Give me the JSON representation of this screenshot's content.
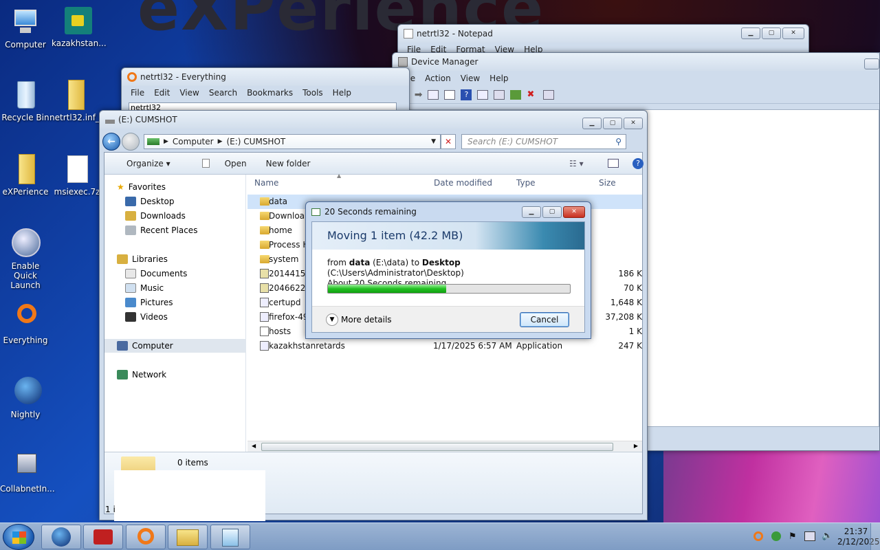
{
  "wallpaper_text": "eXPerience",
  "desktop_icons": [
    {
      "label": "Computer",
      "icon": "computer-icon"
    },
    {
      "label": "kazakhstan...",
      "icon": "app-icon"
    },
    {
      "label": "Recycle Bin",
      "icon": "recycle-bin-icon"
    },
    {
      "label": "netrtl32.inf_...",
      "icon": "folder-icon"
    },
    {
      "label": "eXPerience",
      "icon": "folder-icon"
    },
    {
      "label": "msiexec.7z",
      "icon": "file-icon"
    },
    {
      "label": "Enable Quick Launch",
      "icon": "quick-launch-icon"
    },
    {
      "label": "Everything",
      "icon": "everything-icon"
    },
    {
      "label": "Nightly",
      "icon": "nightly-icon"
    },
    {
      "label": "CollabnetIn...",
      "icon": "installer-icon"
    }
  ],
  "notepad": {
    "title": "netrtl32 - Notepad",
    "menu": [
      "File",
      "Edit",
      "Format",
      "View",
      "Help"
    ]
  },
  "device_manager": {
    "title": "Device Manager",
    "menu": [
      "File",
      "Action",
      "View",
      "Help"
    ]
  },
  "everything": {
    "title": "netrtl32 - Everything",
    "menu": [
      "File",
      "Edit",
      "View",
      "Search",
      "Bookmarks",
      "Tools",
      "Help"
    ],
    "search_value": "netrtl32"
  },
  "explorer": {
    "title": "(E:) CUMSHOT",
    "breadcrumb": [
      "Computer",
      "(E:) CUMSHOT"
    ],
    "search_placeholder": "Search (E:) CUMSHOT",
    "toolbar": {
      "organize": "Organize",
      "open": "Open",
      "new_folder": "New folder"
    },
    "nav": {
      "favorites": "Favorites",
      "desktop": "Desktop",
      "downloads": "Downloads",
      "recent": "Recent Places",
      "libraries": "Libraries",
      "documents": "Documents",
      "music": "Music",
      "pictures": "Pictures",
      "videos": "Videos",
      "computer": "Computer",
      "network": "Network"
    },
    "columns": {
      "name": "Name",
      "date": "Date modified",
      "type": "Type",
      "size": "Size"
    },
    "rows": [
      {
        "name": "data",
        "date": "",
        "type": "",
        "size": "",
        "kind": "folder"
      },
      {
        "name": "Downloa",
        "date": "",
        "type": "",
        "size": "",
        "kind": "folder"
      },
      {
        "name": "home",
        "date": "",
        "type": "",
        "size": "",
        "kind": "folder"
      },
      {
        "name": "Process H",
        "date": "",
        "type": "",
        "size": "",
        "kind": "folder"
      },
      {
        "name": "system",
        "date": "",
        "type": "",
        "size": "",
        "kind": "folder"
      },
      {
        "name": "20144158",
        "date": "",
        "type": "",
        "size": "186 K",
        "kind": "archive"
      },
      {
        "name": "20466220",
        "date": "",
        "type": "",
        "size": "70 K",
        "kind": "archive"
      },
      {
        "name": "certupd",
        "date": "",
        "type": "",
        "size": "1,648 K",
        "kind": "app"
      },
      {
        "name": "firefox-49",
        "date": "",
        "type": "",
        "size": "37,208 K",
        "kind": "app"
      },
      {
        "name": "hosts",
        "date": "",
        "type": "",
        "size": "1 K",
        "kind": "file"
      },
      {
        "name": "kazakhstanretards",
        "date": "1/17/2025 6:57 AM",
        "type": "Application",
        "size": "247 K",
        "kind": "app"
      }
    ],
    "status_items": "0 items",
    "status_left": "1 i"
  },
  "copy_dialog": {
    "title": "20 Seconds remaining",
    "heading": "Moving 1 item (42.2 MB)",
    "from_word": "from",
    "src_name": "data",
    "src_path": "(E:\\data)",
    "to_word": "to",
    "dst_name": "Desktop",
    "dst_path": "(C:\\Users\\Administrator\\Desktop)",
    "remaining": "About 20 Seconds remaining",
    "progress_fraction": 0.49,
    "more_details": "More details",
    "cancel": "Cancel"
  },
  "taskbar": {
    "time": "21:37",
    "date": "2/12/2025"
  }
}
